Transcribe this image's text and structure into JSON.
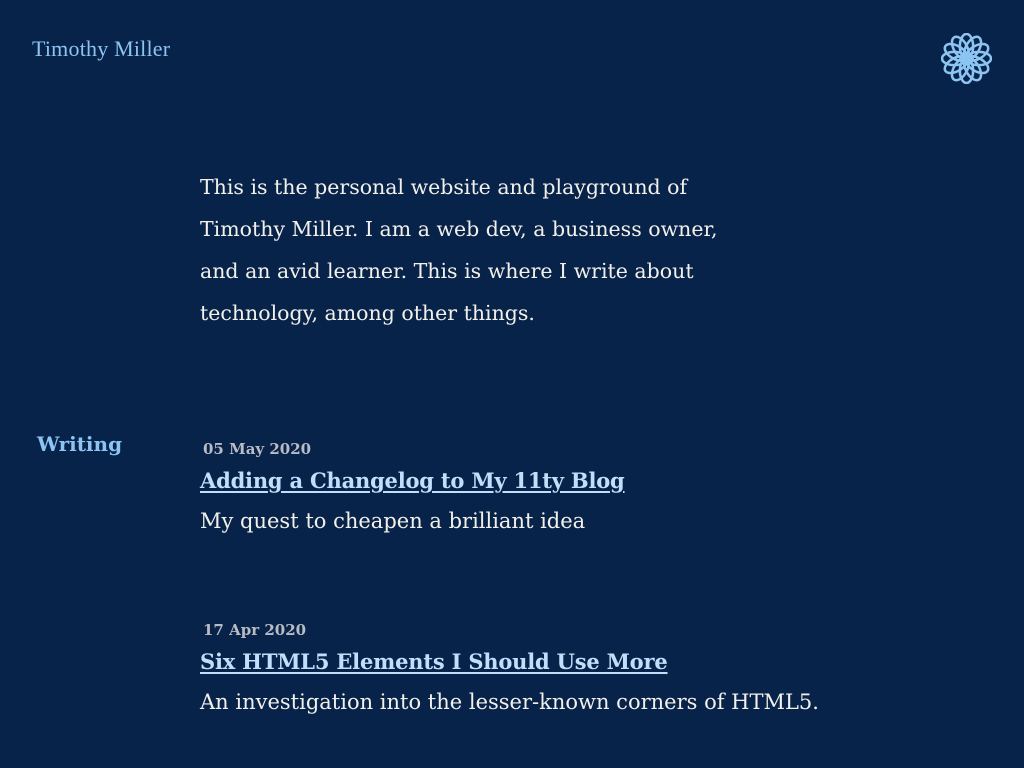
{
  "header": {
    "site_name": "Timothy Miller",
    "logo_icon": "mandala-logo-icon",
    "logo_color": "#8cc4f2"
  },
  "intro": {
    "text": "This is the personal website and playground of Timothy Miller. I am a web dev, a business owner, and an avid learner. This is where I write about technology, among other things."
  },
  "writing": {
    "label": "Writing",
    "posts": [
      {
        "date": "05 May 2020",
        "title": "Adding a Changelog to My 11ty Blog",
        "description": "My quest to cheapen a brilliant idea"
      },
      {
        "date": "17 Apr 2020",
        "title": "Six HTML5 Elements I Should Use More",
        "description": "An investigation into the lesser-known corners of HTML5."
      }
    ]
  },
  "colors": {
    "background": "#08234a",
    "accent": "#8cc4f2",
    "link": "#bfe0fb",
    "text": "#f2f0ea",
    "muted": "#b9bcc4"
  }
}
